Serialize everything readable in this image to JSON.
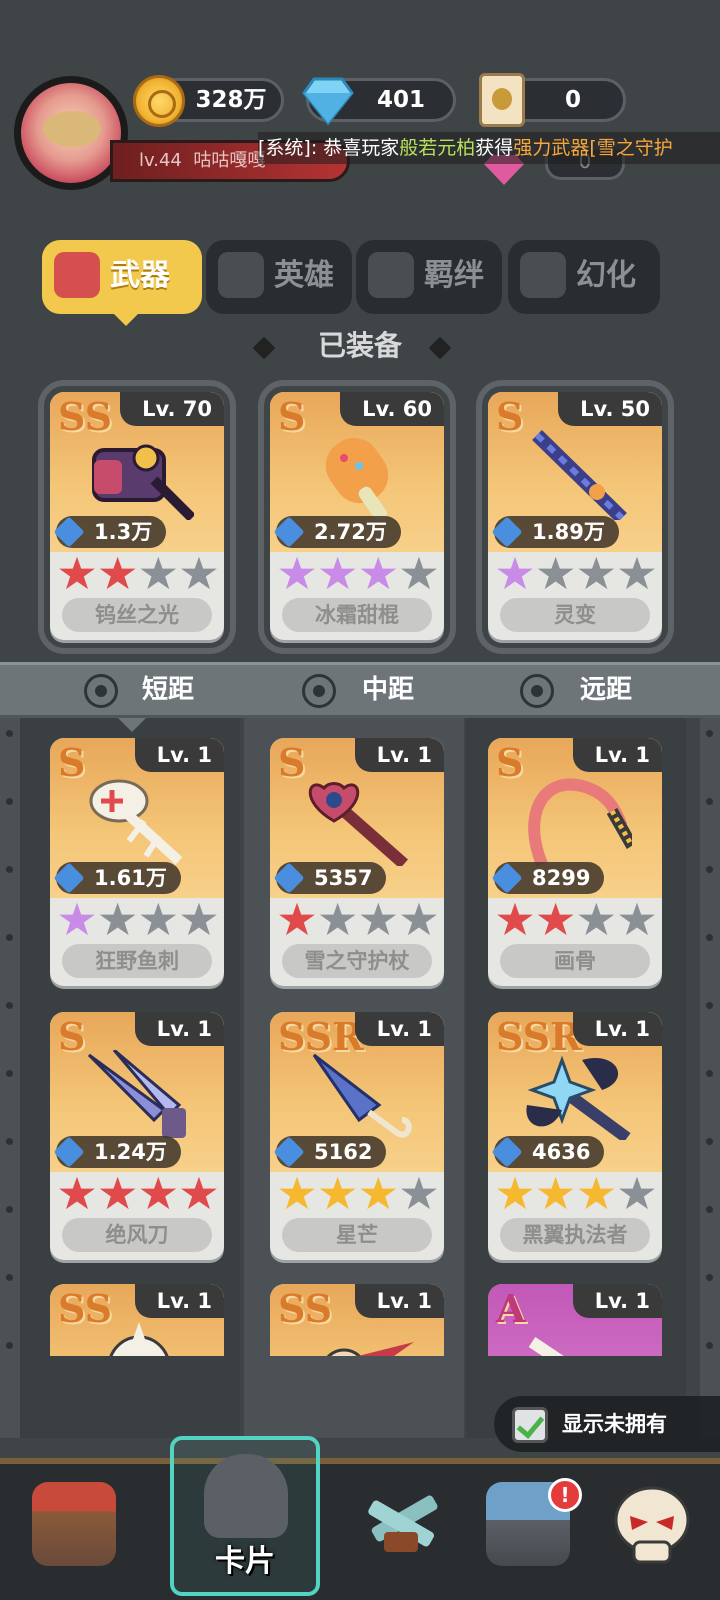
{
  "player": {
    "level": "lv.44",
    "name": "咕咕嘎嘎"
  },
  "currencies": [
    {
      "icon": "gold-coin-icon",
      "value": "328万"
    },
    {
      "icon": "diamond-icon",
      "value": "401"
    },
    {
      "icon": "scroll-icon",
      "value": "0"
    }
  ],
  "ticker": {
    "prefix": "[系统]: 恭喜玩家",
    "player": "般若元柏",
    "verb": "获得",
    "item": "强力武器[雪之守护"
  },
  "tabs": [
    {
      "label": "武器",
      "active": true
    },
    {
      "label": "英雄",
      "active": false
    },
    {
      "label": "羁绊",
      "active": false
    },
    {
      "label": "幻化",
      "active": false
    }
  ],
  "equipped": {
    "title": "已装备",
    "cards": [
      {
        "grade": "SS",
        "level": "Lv. 70",
        "power": "1.3万",
        "stars": [
          "red",
          "red",
          "gray",
          "gray"
        ],
        "name": "钨丝之光"
      },
      {
        "grade": "S",
        "level": "Lv. 60",
        "power": "2.72万",
        "stars": [
          "purple",
          "purple",
          "purple",
          "gray"
        ],
        "name": "冰霜甜棍"
      },
      {
        "grade": "S",
        "level": "Lv. 50",
        "power": "1.89万",
        "stars": [
          "purple",
          "gray",
          "gray",
          "gray"
        ],
        "name": "灵变"
      }
    ]
  },
  "ranges": [
    "短距",
    "中距",
    "远距"
  ],
  "weapons": [
    {
      "grade": "S",
      "level": "Lv. 1",
      "power": "1.61万",
      "stars": [
        "purple",
        "gray",
        "gray",
        "gray"
      ],
      "name": "狂野鱼刺"
    },
    {
      "grade": "S",
      "level": "Lv. 1",
      "power": "5357",
      "stars": [
        "red",
        "gray",
        "gray",
        "gray"
      ],
      "name": "雪之守护杖"
    },
    {
      "grade": "S",
      "level": "Lv. 1",
      "power": "8299",
      "stars": [
        "red",
        "red",
        "gray",
        "gray"
      ],
      "name": "画骨"
    },
    {
      "grade": "S",
      "level": "Lv. 1",
      "power": "1.24万",
      "stars": [
        "red",
        "red",
        "red",
        "red"
      ],
      "name": "绝风刀"
    },
    {
      "grade": "SSR",
      "level": "Lv. 1",
      "power": "5162",
      "stars": [
        "gold",
        "gold",
        "gold",
        "gray"
      ],
      "name": "星芒"
    },
    {
      "grade": "SSR",
      "level": "Lv. 1",
      "power": "4636",
      "stars": [
        "gold",
        "gold",
        "gold",
        "gray"
      ],
      "name": "黑翼执法者"
    },
    {
      "grade": "SS",
      "level": "Lv. 1"
    },
    {
      "grade": "SS",
      "level": "Lv. 1"
    },
    {
      "grade": "A",
      "level": "Lv. 1"
    }
  ],
  "show_unowned": {
    "label": "显示未拥有",
    "checked": true
  },
  "bottom_nav": [
    {
      "icon": "shop-icon",
      "label": ""
    },
    {
      "icon": "knight-helmet-icon",
      "label": "卡片",
      "active": true
    },
    {
      "icon": "crossed-guns-icon",
      "label": ""
    },
    {
      "icon": "treasure-chest-icon",
      "label": "",
      "badge": "!"
    },
    {
      "icon": "skull-icon",
      "label": ""
    }
  ],
  "colors": {
    "active_tab": "#f2c94c",
    "star_red": "#e14a4a",
    "star_purple": "#c98be8",
    "star_gold": "#f5b82e",
    "nav_highlight": "#53d3c2"
  }
}
